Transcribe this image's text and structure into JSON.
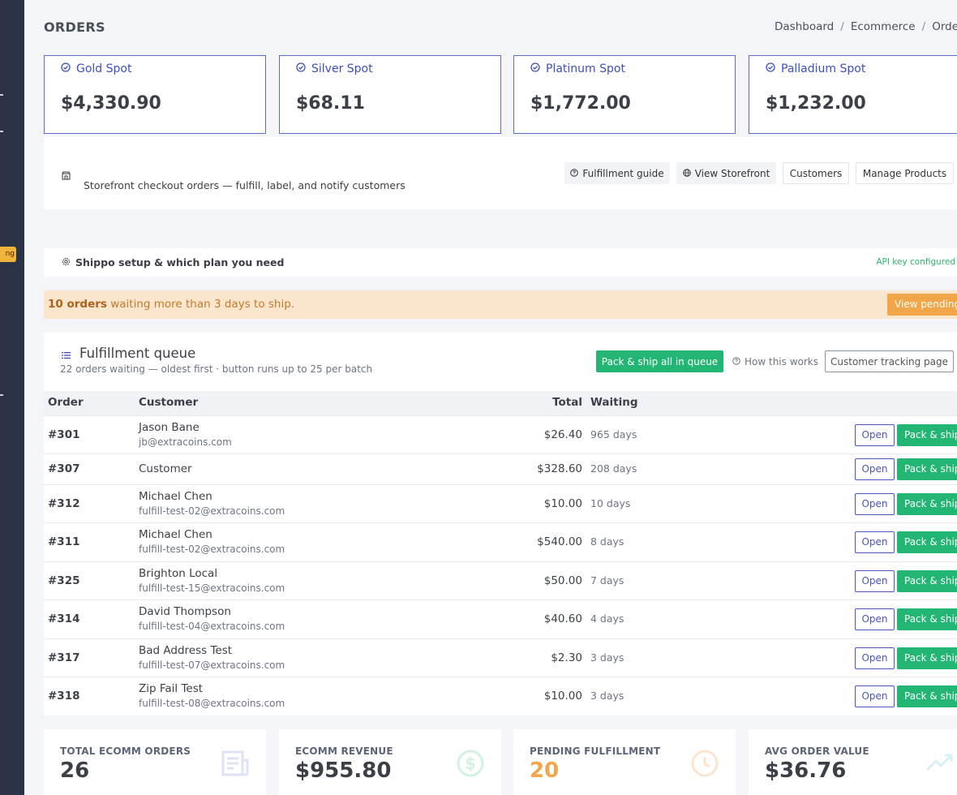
{
  "sidebar": {
    "badge_label": "ng"
  },
  "header": {
    "title": "ORDERS",
    "breadcrumb": [
      "Dashboard",
      "Ecommerce",
      "Orde"
    ]
  },
  "spots": [
    {
      "name": "Gold Spot",
      "price": "$4,330.90"
    },
    {
      "name": "Silver Spot",
      "price": "$68.11"
    },
    {
      "name": "Platinum Spot",
      "price": "$1,772.00"
    },
    {
      "name": "Palladium Spot",
      "price": "$1,232.00"
    }
  ],
  "storefront": {
    "description": "Storefront checkout orders — fulfill, label, and notify customers",
    "fulfillment_guide_label": "Fulfillment guide",
    "view_storefront_label": "View Storefront",
    "customers_label": "Customers",
    "manage_products_label": "Manage Products"
  },
  "shippo": {
    "title": "Shippo setup & which plan you need",
    "status": "API key configured"
  },
  "alert": {
    "count_text": "10 orders",
    "message": " waiting more than 3 days to ship.",
    "button_label": "View pending"
  },
  "queue": {
    "title": "Fulfillment queue",
    "subtitle": "22 orders waiting — oldest first · button runs up to 25 per batch",
    "pack_all_label": "Pack & ship all in queue",
    "how_label": "How this works",
    "tracking_label": "Customer tracking page",
    "columns": {
      "order": "Order",
      "customer": "Customer",
      "total": "Total",
      "waiting": "Waiting"
    },
    "open_label": "Open",
    "pack_label": "Pack & ship",
    "rows": [
      {
        "order": "#301",
        "name": "Jason Bane",
        "email": "jb@extracoins.com",
        "total": "$26.40",
        "waiting": "965 days"
      },
      {
        "order": "#307",
        "name": "Customer",
        "email": "",
        "total": "$328.60",
        "waiting": "208 days"
      },
      {
        "order": "#312",
        "name": "Michael Chen",
        "email": "fulfill-test-02@extracoins.com",
        "total": "$10.00",
        "waiting": "10 days"
      },
      {
        "order": "#311",
        "name": "Michael Chen",
        "email": "fulfill-test-02@extracoins.com",
        "total": "$540.00",
        "waiting": "8 days"
      },
      {
        "order": "#325",
        "name": "Brighton Local",
        "email": "fulfill-test-15@extracoins.com",
        "total": "$50.00",
        "waiting": "7 days"
      },
      {
        "order": "#314",
        "name": "David Thompson",
        "email": "fulfill-test-04@extracoins.com",
        "total": "$40.60",
        "waiting": "4 days"
      },
      {
        "order": "#317",
        "name": "Bad Address Test",
        "email": "fulfill-test-07@extracoins.com",
        "total": "$2.30",
        "waiting": "3 days"
      },
      {
        "order": "#318",
        "name": "Zip Fail Test",
        "email": "fulfill-test-08@extracoins.com",
        "total": "$10.00",
        "waiting": "3 days"
      }
    ]
  },
  "stats": [
    {
      "label": "TOTAL ECOMM ORDERS",
      "value": "26",
      "icon": "receipt-icon"
    },
    {
      "label": "ECOMM REVENUE",
      "value": "$955.80",
      "icon": "dollar-icon"
    },
    {
      "label": "PENDING FULFILLMENT",
      "value": "20",
      "icon": "clock-icon"
    },
    {
      "label": "AVG ORDER VALUE",
      "value": "$36.76",
      "icon": "trending-up-icon"
    }
  ],
  "colors": {
    "accent": "#3d4fbf",
    "success": "#22b573",
    "warning": "#f2a64a",
    "warning_bg": "#fbe6cd",
    "pending_value": "#f2a64a",
    "sidebar": "#2b3346"
  }
}
